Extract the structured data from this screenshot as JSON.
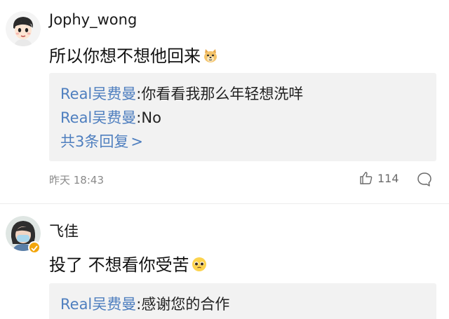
{
  "comments": [
    {
      "username": "Jophy_wong",
      "text": "所以你想不想他回来",
      "emoji": "doge-emoji",
      "replies": [
        {
          "user": "Real吴费曼",
          "separator": ":",
          "text": "你看看我那么年轻想洗咩"
        },
        {
          "user": "Real吴费曼",
          "separator": ":",
          "text": "No"
        }
      ],
      "more_replies": "共3条回复",
      "more_arrow": ">",
      "time": "昨天 18:43",
      "like_count": "114"
    },
    {
      "username": "飞佳",
      "text": "投了 不想看你受苦",
      "emoji": "pleading-face-emoji",
      "verified_color": "#f3a60c",
      "replies": [
        {
          "user": "Real吴费曼",
          "separator": ":",
          "text": "感谢您的合作"
        }
      ]
    }
  ],
  "colors": {
    "link": "#4f7fbf",
    "reply_bg": "#f2f2f2",
    "meta": "#8a8a8a"
  }
}
